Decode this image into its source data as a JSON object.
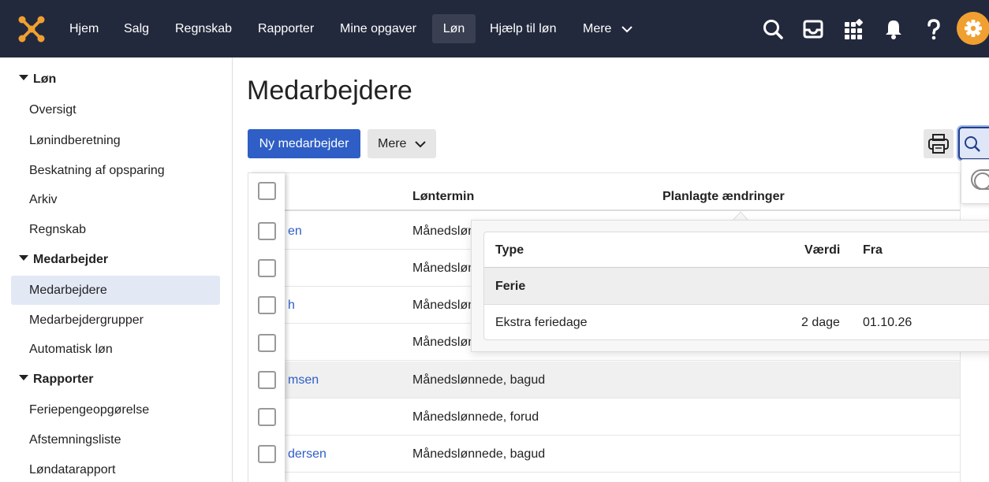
{
  "topbar": {
    "logo": "dinero-logo-icon",
    "nav": [
      "Hjem",
      "Salg",
      "Regnskab",
      "Rapporter",
      "Mine opgaver",
      "Løn",
      "Hjælp til løn",
      "Mere"
    ],
    "active": "Løn",
    "icons": [
      "search-icon",
      "inbox-icon",
      "apps-grid-icon",
      "bell-icon",
      "help-icon",
      "gear-icon"
    ],
    "accent": "#f0a030",
    "background": "#23293d"
  },
  "sidebar": {
    "sections": [
      {
        "label": "Løn",
        "items": [
          "Oversigt",
          "Lønindberetning",
          "Beskatning af opsparing",
          "Arkiv",
          "Regnskab"
        ]
      },
      {
        "label": "Medarbejder",
        "items": [
          "Medarbejdere",
          "Medarbejdergrupper",
          "Automatisk løn"
        ]
      },
      {
        "label": "Rapporter",
        "items": [
          "Feriepengeopgørelse",
          "Afstemningsliste",
          "Løndatarapport"
        ]
      }
    ],
    "active_item": "Medarbejdere"
  },
  "main": {
    "title": "Medarbejdere",
    "new_button": "Ny medarbejder",
    "more_button": "Mere",
    "table": {
      "headers": {
        "term": "Løntermin",
        "changes": "Planlagte ændringer"
      },
      "rows": [
        {
          "name": "en",
          "term": "Månedslønnede, bagud"
        },
        {
          "name": "",
          "term": "Månedslønnede, bagud"
        },
        {
          "name": "h",
          "term": "Månedslønnede, bagud"
        },
        {
          "name": "",
          "term": "Månedslønnede, bagud"
        },
        {
          "name": "msen",
          "term": "Månedslønnede, bagud"
        },
        {
          "name": "",
          "term": "Månedslønnede, forud"
        },
        {
          "name": "dersen",
          "term": "Månedslønnede, bagud"
        }
      ],
      "visible_row_terms": [
        "Månedslønr",
        "Månedslønr",
        "Månedslønr",
        "Månedslønr"
      ]
    },
    "popover": {
      "headers": {
        "type": "Type",
        "value": "Værdi",
        "from": "Fra"
      },
      "group": "Ferie",
      "row": {
        "type": "Ekstra feriedage",
        "value": "2 dage",
        "from": "01.10.26"
      }
    }
  }
}
